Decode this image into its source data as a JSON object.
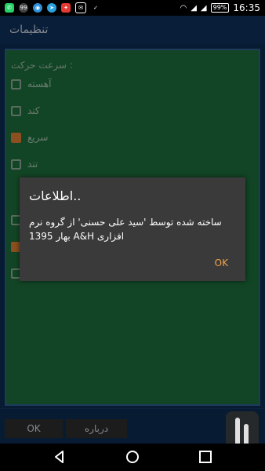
{
  "status_bar": {
    "notification_count": "99",
    "battery_percent": "99%",
    "time": "16:35",
    "icons": [
      "whatsapp-icon",
      "badge-99-icon",
      "chrome-icon",
      "telegram-icon",
      "red-app-icon",
      "mail-icon",
      "check-icon",
      "wifi-icon",
      "signal-icon",
      "signal-icon",
      "battery-icon"
    ]
  },
  "app_bar": {
    "title": "تنظیمات"
  },
  "settings": {
    "section_speed": "سرعت حرکت :",
    "options": [
      {
        "label": "آهسته",
        "checked": false
      },
      {
        "label": "کند",
        "checked": false
      },
      {
        "label": "سریع",
        "checked": true
      },
      {
        "label": "تند",
        "checked": false
      }
    ]
  },
  "dialog": {
    "title": "اطلاعات..",
    "message": "ساخته شده توسط 'سید علی حسنی' از گروه نرم افزاری A&H بهار 1395",
    "ok_label": "OK"
  },
  "buttons": {
    "ok_label": "OK",
    "about_label": "درباره"
  },
  "colors": {
    "content_bg": "#1c6a3a",
    "accent": "#d87a32",
    "dialog_bg": "#3a3a3a",
    "app_bar": "#0e2f56"
  }
}
